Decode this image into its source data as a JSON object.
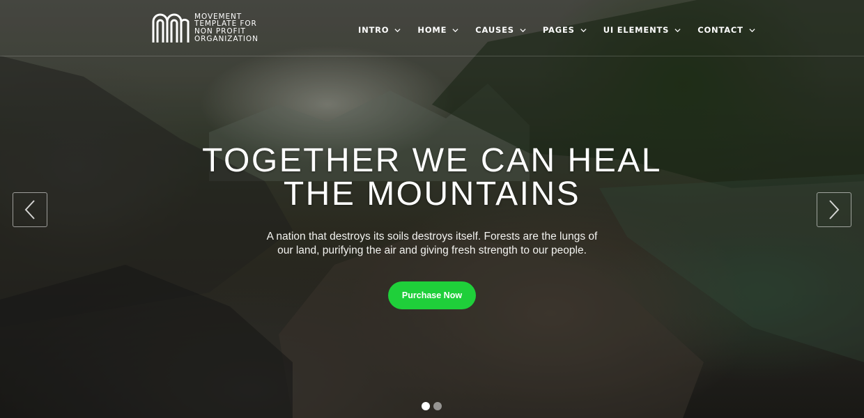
{
  "logo": {
    "lines": [
      "MOVEMENT",
      "TEMPLATE FOR",
      "NON PROFIT",
      "ORGANIZATION"
    ],
    "icon": "movement-logo-icon"
  },
  "nav": {
    "items": [
      {
        "label": "INTRO",
        "icon": "chevron-down-icon"
      },
      {
        "label": "HOME",
        "icon": "chevron-down-icon"
      },
      {
        "label": "CAUSES",
        "icon": "chevron-down-icon"
      },
      {
        "label": "PAGES",
        "icon": "chevron-down-icon"
      },
      {
        "label": "UI ELEMENTS",
        "icon": "chevron-down-icon"
      },
      {
        "label": "CONTACT",
        "icon": "chevron-down-icon"
      }
    ]
  },
  "hero": {
    "title_line1": "TOGETHER WE CAN HEAL",
    "title_line2": "THE MOUNTAINS",
    "subtitle": "A nation that destroys its soils destroys itself. Forests are the lungs of our land, purifying the air and giving fresh strength to our people.",
    "cta_label": "Purchase Now"
  },
  "slider": {
    "prev_icon": "chevron-left-icon",
    "next_icon": "chevron-right-icon",
    "slide_count": 2,
    "active_slide": 1
  },
  "colors": {
    "cta": "#1fcf3a",
    "text": "#ffffff"
  }
}
